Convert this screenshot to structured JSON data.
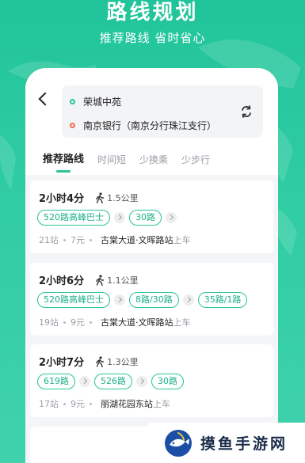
{
  "hero": {
    "title": "路线规划",
    "subtitle": "推荐路线  省时省心"
  },
  "search": {
    "origin": "荣城中苑",
    "destination": "南京银行（南京分行珠江支行）"
  },
  "icons": {
    "back": "back-arrow-icon",
    "swap": "swap-icon",
    "walk": "walk-icon",
    "chevron": "chevron-right-icon",
    "watermark_logo": "fish-logo-icon"
  },
  "tabs": [
    {
      "label": "推荐路线",
      "active": true
    },
    {
      "label": "时间短",
      "active": false
    },
    {
      "label": "少换乘",
      "active": false
    },
    {
      "label": "少步行",
      "active": false
    }
  ],
  "routes": [
    {
      "duration": "2小时4分",
      "walk": "1.5公里",
      "lines": [
        "520路高峰巴士",
        "30路"
      ],
      "stations": "21站",
      "price": "7元",
      "boarding_stop": "古棠大道·文晖路站",
      "boarding_suffix": "上车"
    },
    {
      "duration": "2小时6分",
      "walk": "1.1公里",
      "lines": [
        "520路高峰巴士",
        "8路/30路",
        "35路/1路"
      ],
      "stations": "19站",
      "price": "9元",
      "boarding_stop": "古棠大道·文晖路站",
      "boarding_suffix": "上车"
    },
    {
      "duration": "2小时7分",
      "walk": "1.3公里",
      "lines": [
        "619路",
        "526路",
        "30路"
      ],
      "stations": "17站",
      "price": "9元",
      "boarding_stop": "丽湖花园东站",
      "boarding_suffix": "上车"
    }
  ],
  "watermark": {
    "text": "摸鱼手游网"
  },
  "colors": {
    "accent": "#28c596",
    "background": "#2fcca3",
    "destination_dot": "#f26a56"
  }
}
